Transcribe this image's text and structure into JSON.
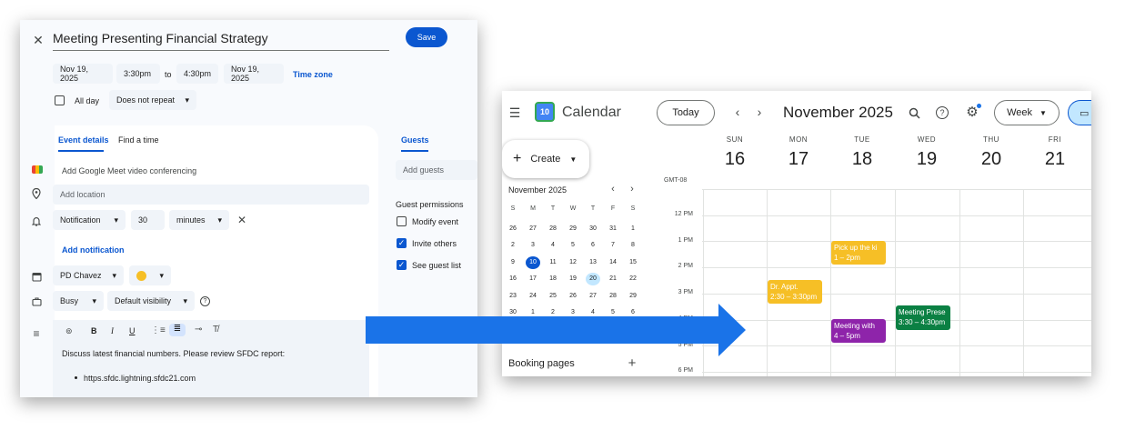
{
  "editor": {
    "title": "Meeting Presenting Financial Strategy",
    "save_label": "Save",
    "start_date": "Nov 19, 2025",
    "start_time": "3:30pm",
    "to_label": "to",
    "end_time": "4:30pm",
    "end_date": "Nov 19, 2025",
    "timezone_label": "Time zone",
    "all_day_label": "All day",
    "repeat_value": "Does not repeat",
    "tabs": [
      "Event details",
      "Find a time"
    ],
    "guests_tab": "Guests",
    "meet_label": "Add Google Meet video conferencing",
    "location_placeholder": "Add location",
    "notification_type": "Notification",
    "notification_value": "30",
    "notification_unit": "minutes",
    "add_notification": "Add notification",
    "calendar_owner": "PD Chavez",
    "event_color": "#f6bf26",
    "busy_value": "Busy",
    "visibility_value": "Default visibility",
    "description_line": "Discuss latest financial numbers. Please review SFDC report:",
    "description_link": "https.sfdc.lightning.sfdc21.com",
    "add_guests_placeholder": "Add guests",
    "guest_permissions_title": "Guest permissions",
    "permissions": [
      {
        "label": "Modify event",
        "checked": false
      },
      {
        "label": "Invite others",
        "checked": true
      },
      {
        "label": "See guest list",
        "checked": true
      }
    ]
  },
  "calendar": {
    "app_name": "Calendar",
    "logo_day": "10",
    "today_label": "Today",
    "month_label": "November 2025",
    "view_label": "Week",
    "create_label": "Create",
    "timezone": "GMT-08",
    "days": [
      {
        "name": "SUN",
        "num": "16"
      },
      {
        "name": "MON",
        "num": "17"
      },
      {
        "name": "TUE",
        "num": "18"
      },
      {
        "name": "WED",
        "num": "19"
      },
      {
        "name": "THU",
        "num": "20"
      },
      {
        "name": "FRI",
        "num": "21"
      }
    ],
    "times": [
      "12 PM",
      "1 PM",
      "2 PM",
      "3 PM",
      "4 PM",
      "5 PM",
      "6 PM"
    ],
    "mini_month": "November 2025",
    "mini_headers": [
      "S",
      "M",
      "T",
      "W",
      "T",
      "F",
      "S"
    ],
    "mini_weeks": [
      [
        "26",
        "27",
        "28",
        "29",
        "30",
        "31",
        "1"
      ],
      [
        "2",
        "3",
        "4",
        "5",
        "6",
        "7",
        "8"
      ],
      [
        "9",
        "10",
        "11",
        "12",
        "13",
        "14",
        "15"
      ],
      [
        "16",
        "17",
        "18",
        "19",
        "20",
        "21",
        "22"
      ],
      [
        "23",
        "24",
        "25",
        "26",
        "27",
        "28",
        "29"
      ],
      [
        "30",
        "1",
        "2",
        "3",
        "4",
        "5",
        "6"
      ]
    ],
    "mini_today": "10",
    "mini_selected": "20",
    "booking_pages_label": "Booking pages",
    "events": [
      {
        "title": "Dr. Appt.",
        "time": "2:30 – 3:30pm",
        "day": 1,
        "start": 14.5,
        "end": 15.5,
        "color": "#f6bf26"
      },
      {
        "title": "Pick up the ki",
        "time": "1 – 2pm",
        "day": 2,
        "start": 13,
        "end": 14,
        "color": "#f6bf26"
      },
      {
        "title": "Meeting with",
        "time": "4 – 5pm",
        "day": 2,
        "start": 16,
        "end": 17,
        "color": "#8e24aa"
      },
      {
        "title": "Meeting Prese",
        "time": "3:30 – 4:30pm",
        "day": 3,
        "start": 15.5,
        "end": 16.5,
        "color": "#0b8043"
      }
    ]
  },
  "colors": {
    "accent": "#0b57d0",
    "arrow": "#1a73e8"
  }
}
